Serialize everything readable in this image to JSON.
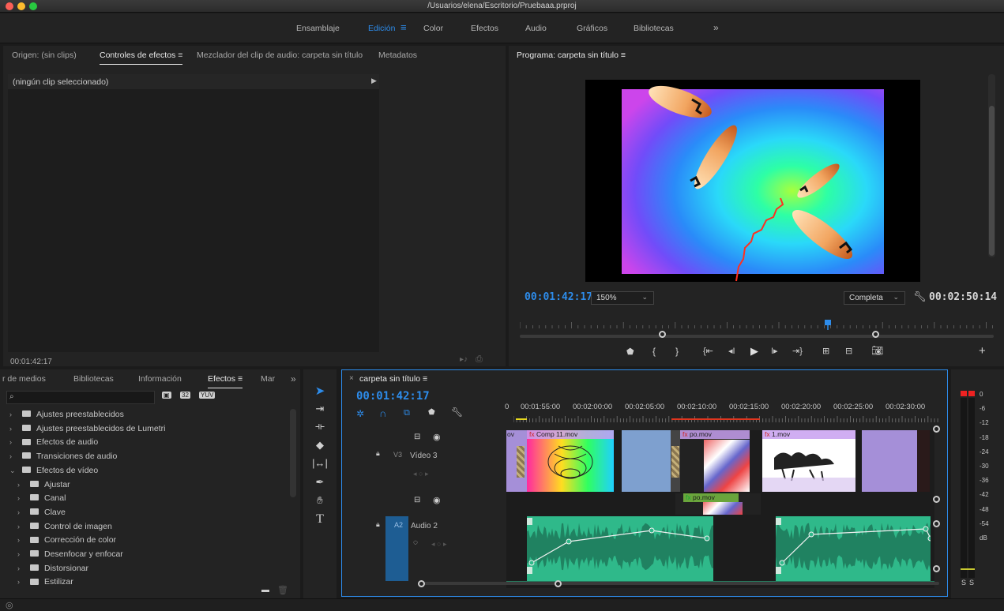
{
  "window": {
    "title": "/Usuarios/elena/Escritorio/Pruebaaa.prproj"
  },
  "workspaces": [
    "Ensamblaje",
    "Edición",
    "Color",
    "Efectos",
    "Audio",
    "Gráficos",
    "Bibliotecas",
    "»"
  ],
  "source_panel": {
    "tabs": [
      "Origen: (sin clips)",
      "Controles de efectos",
      "Mezclador del clip de audio: carpeta sin título",
      "Metadatos"
    ],
    "no_clip": "(ningún clip seleccionado)",
    "timecode": "00:01:42:17"
  },
  "program_monitor": {
    "title": "Programa: carpeta sin título",
    "timecode": "00:01:42:17",
    "zoom": "150%",
    "quality": "Completa",
    "duration": "00:02:50:14",
    "playhead_fraction": 0.65
  },
  "project_panel": {
    "tabs": [
      "r de medios",
      "Bibliotecas",
      "Información",
      "Efectos",
      "Mar",
      "»"
    ],
    "search_placeholder": "",
    "tree": [
      {
        "label": "Ajustes preestablecidos",
        "expanded": false,
        "indent": 0
      },
      {
        "label": "Ajustes preestablecidos de Lumetri",
        "expanded": false,
        "indent": 0
      },
      {
        "label": "Efectos de audio",
        "expanded": false,
        "indent": 0
      },
      {
        "label": "Transiciones de audio",
        "expanded": false,
        "indent": 0
      },
      {
        "label": "Efectos de vídeo",
        "expanded": true,
        "indent": 0
      },
      {
        "label": "Ajustar",
        "expanded": false,
        "indent": 1
      },
      {
        "label": "Canal",
        "expanded": false,
        "indent": 1
      },
      {
        "label": "Clave",
        "expanded": false,
        "indent": 1
      },
      {
        "label": "Control de imagen",
        "expanded": false,
        "indent": 1
      },
      {
        "label": "Corrección de color",
        "expanded": false,
        "indent": 1
      },
      {
        "label": "Desenfocar y enfocar",
        "expanded": false,
        "indent": 1
      },
      {
        "label": "Distorsionar",
        "expanded": false,
        "indent": 1
      },
      {
        "label": "Estilizar",
        "expanded": false,
        "indent": 1
      }
    ]
  },
  "timeline": {
    "sequence": "carpeta sin título",
    "timecode": "00:01:42:17",
    "ruler": [
      "0",
      "00:01:55:00",
      "00:02:00:00",
      "00:02:05:00",
      "00:02:10:00",
      "00:02:15:00",
      "00:02:20:00",
      "00:02:25:00",
      "00:02:30:00"
    ],
    "tracks": {
      "v3": {
        "id": "V3",
        "name": "Vídeo 3"
      },
      "a2": {
        "id": "A2",
        "name": "Audio 2"
      }
    },
    "clips": {
      "c0": "ov",
      "c1": "Comp 11.mov",
      "c2": "po.mov",
      "c3": "1.mov",
      "c4": "po.mov",
      "fx": "fx"
    }
  },
  "audio_meter": {
    "labels": [
      "0",
      "-6",
      "-12",
      "-18",
      "-24",
      "-30",
      "-36",
      "-42",
      "-48",
      "-54",
      "dB"
    ],
    "solo": [
      "S",
      "S"
    ]
  },
  "colors": {
    "accent": "#2d8ceb",
    "audio_clip": "#2fb98a",
    "video_clip": "#a58fd8",
    "playhead": "#2d8ceb"
  }
}
